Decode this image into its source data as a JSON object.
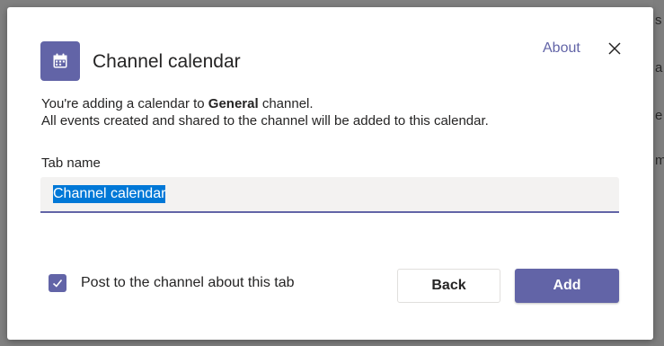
{
  "background": {
    "edge_text": [
      "s",
      "a",
      "e",
      "m"
    ]
  },
  "dialog": {
    "app_icon": "calendar-icon",
    "title": "Channel calendar",
    "about_label": "About",
    "close_icon": "close-icon",
    "description": {
      "line1_prefix": "You're adding a calendar to ",
      "line1_channel": "General",
      "line1_suffix": " channel.",
      "line2": "All events created and shared to the channel will be added to this calendar."
    },
    "tab_name": {
      "label": "Tab name",
      "value": "Channel calendar"
    },
    "post_option": {
      "checked": true,
      "label": "Post to the channel about this tab"
    },
    "buttons": {
      "back": "Back",
      "add": "Add"
    }
  },
  "colors": {
    "accent": "#6264a7",
    "selection": "#0078d7",
    "input_bg": "#f3f2f1",
    "text": "#252424"
  }
}
